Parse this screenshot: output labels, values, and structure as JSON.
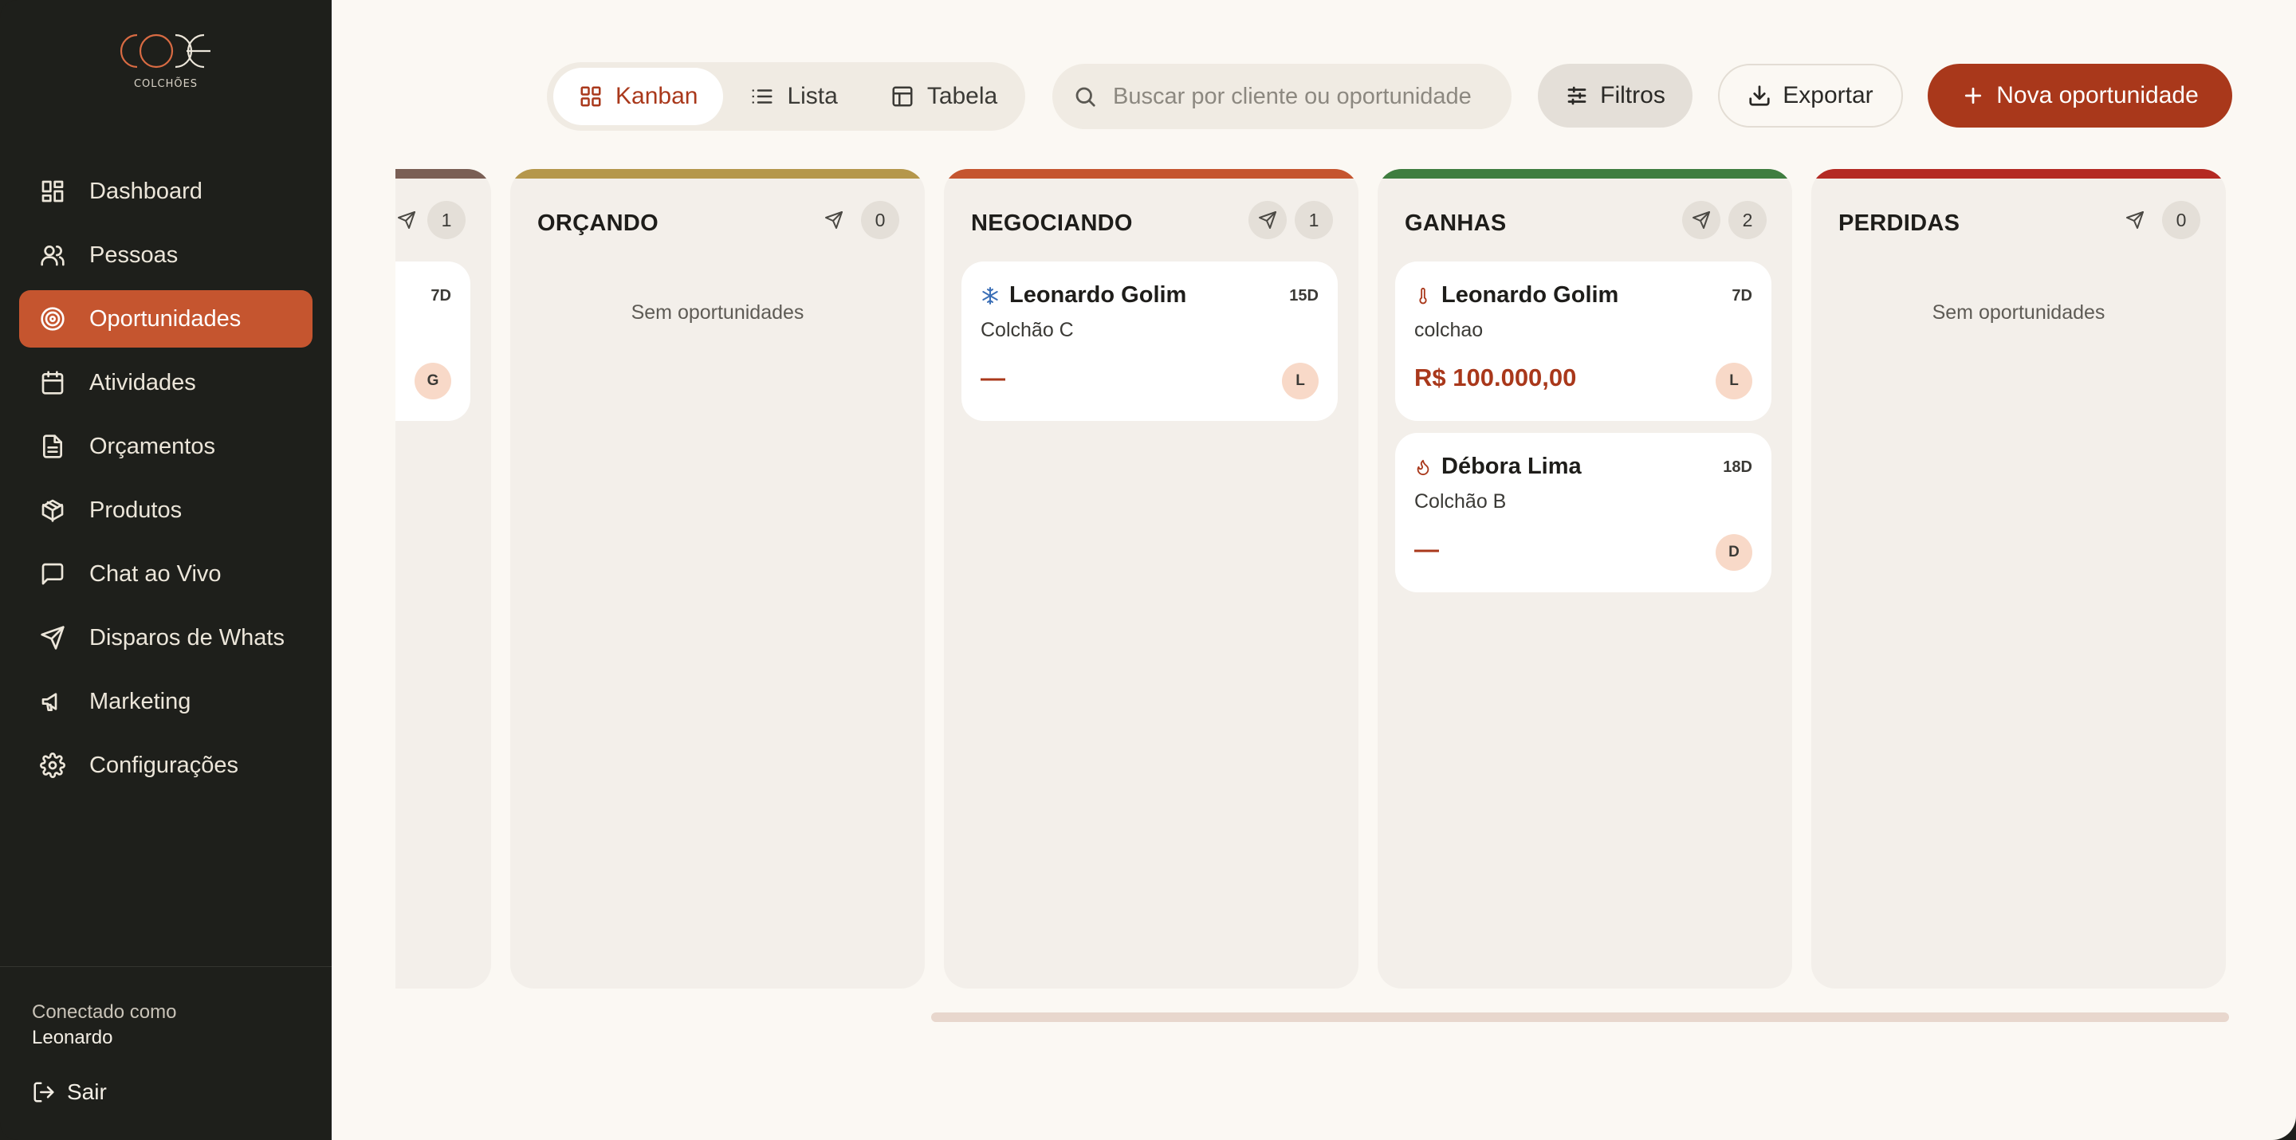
{
  "brand": {
    "name": "CODE",
    "subtitle": "COLCHÕES",
    "accent_color": "#c5552f"
  },
  "sidebar": {
    "items": [
      {
        "label": "Dashboard",
        "icon": "dashboard-icon",
        "active": false
      },
      {
        "label": "Pessoas",
        "icon": "users-icon",
        "active": false
      },
      {
        "label": "Oportunidades",
        "icon": "target-icon",
        "active": true
      },
      {
        "label": "Atividades",
        "icon": "calendar-icon",
        "active": false
      },
      {
        "label": "Orçamentos",
        "icon": "document-icon",
        "active": false
      },
      {
        "label": "Produtos",
        "icon": "box-icon",
        "active": false
      },
      {
        "label": "Chat ao Vivo",
        "icon": "chat-icon",
        "active": false
      },
      {
        "label": "Disparos de Whats",
        "icon": "send-icon",
        "active": false
      },
      {
        "label": "Marketing",
        "icon": "megaphone-icon",
        "active": false
      },
      {
        "label": "Configurações",
        "icon": "gear-icon",
        "active": false
      }
    ],
    "connected_label": "Conectado como",
    "connected_user": "Leonardo",
    "logout_label": "Sair"
  },
  "toolbar": {
    "views": [
      {
        "label": "Kanban",
        "icon": "grid-icon",
        "active": true
      },
      {
        "label": "Lista",
        "icon": "list-icon",
        "active": false
      },
      {
        "label": "Tabela",
        "icon": "table-icon",
        "active": false
      }
    ],
    "search_placeholder": "Buscar por cliente ou oportunidade",
    "filters_label": "Filtros",
    "export_label": "Exportar",
    "new_label": "Nova oportunidade"
  },
  "board": {
    "partial_column": {
      "count": "1",
      "bar_color": "#7a5f55",
      "card": {
        "days": "7D",
        "avatar": "G"
      }
    },
    "columns": [
      {
        "title": "ORÇANDO",
        "count": "0",
        "bar_color": "#b5974b",
        "empty_text": "Sem oportunidades",
        "cards": []
      },
      {
        "title": "NEGOCIANDO",
        "count": "1",
        "bar_color": "#c5552f",
        "empty_text": "",
        "cards": [
          {
            "name": "Leonardo Golim",
            "temp_icon": "snowflake-icon",
            "days": "15D",
            "product": "Colchão C",
            "value": "—",
            "avatar": "L"
          }
        ]
      },
      {
        "title": "GANHAS",
        "count": "2",
        "bar_color": "#3f7d3f",
        "empty_text": "",
        "cards": [
          {
            "name": "Leonardo Golim",
            "temp_icon": "thermometer-icon",
            "days": "7D",
            "product": "colchao",
            "value": "R$ 100.000,00",
            "avatar": "L"
          },
          {
            "name": "Débora Lima",
            "temp_icon": "flame-icon",
            "days": "18D",
            "product": "Colchão B",
            "value": "—",
            "avatar": "D"
          }
        ]
      },
      {
        "title": "PERDIDAS",
        "count": "0",
        "bar_color": "#b42a23",
        "empty_text": "Sem oportunidades",
        "cards": []
      }
    ]
  }
}
